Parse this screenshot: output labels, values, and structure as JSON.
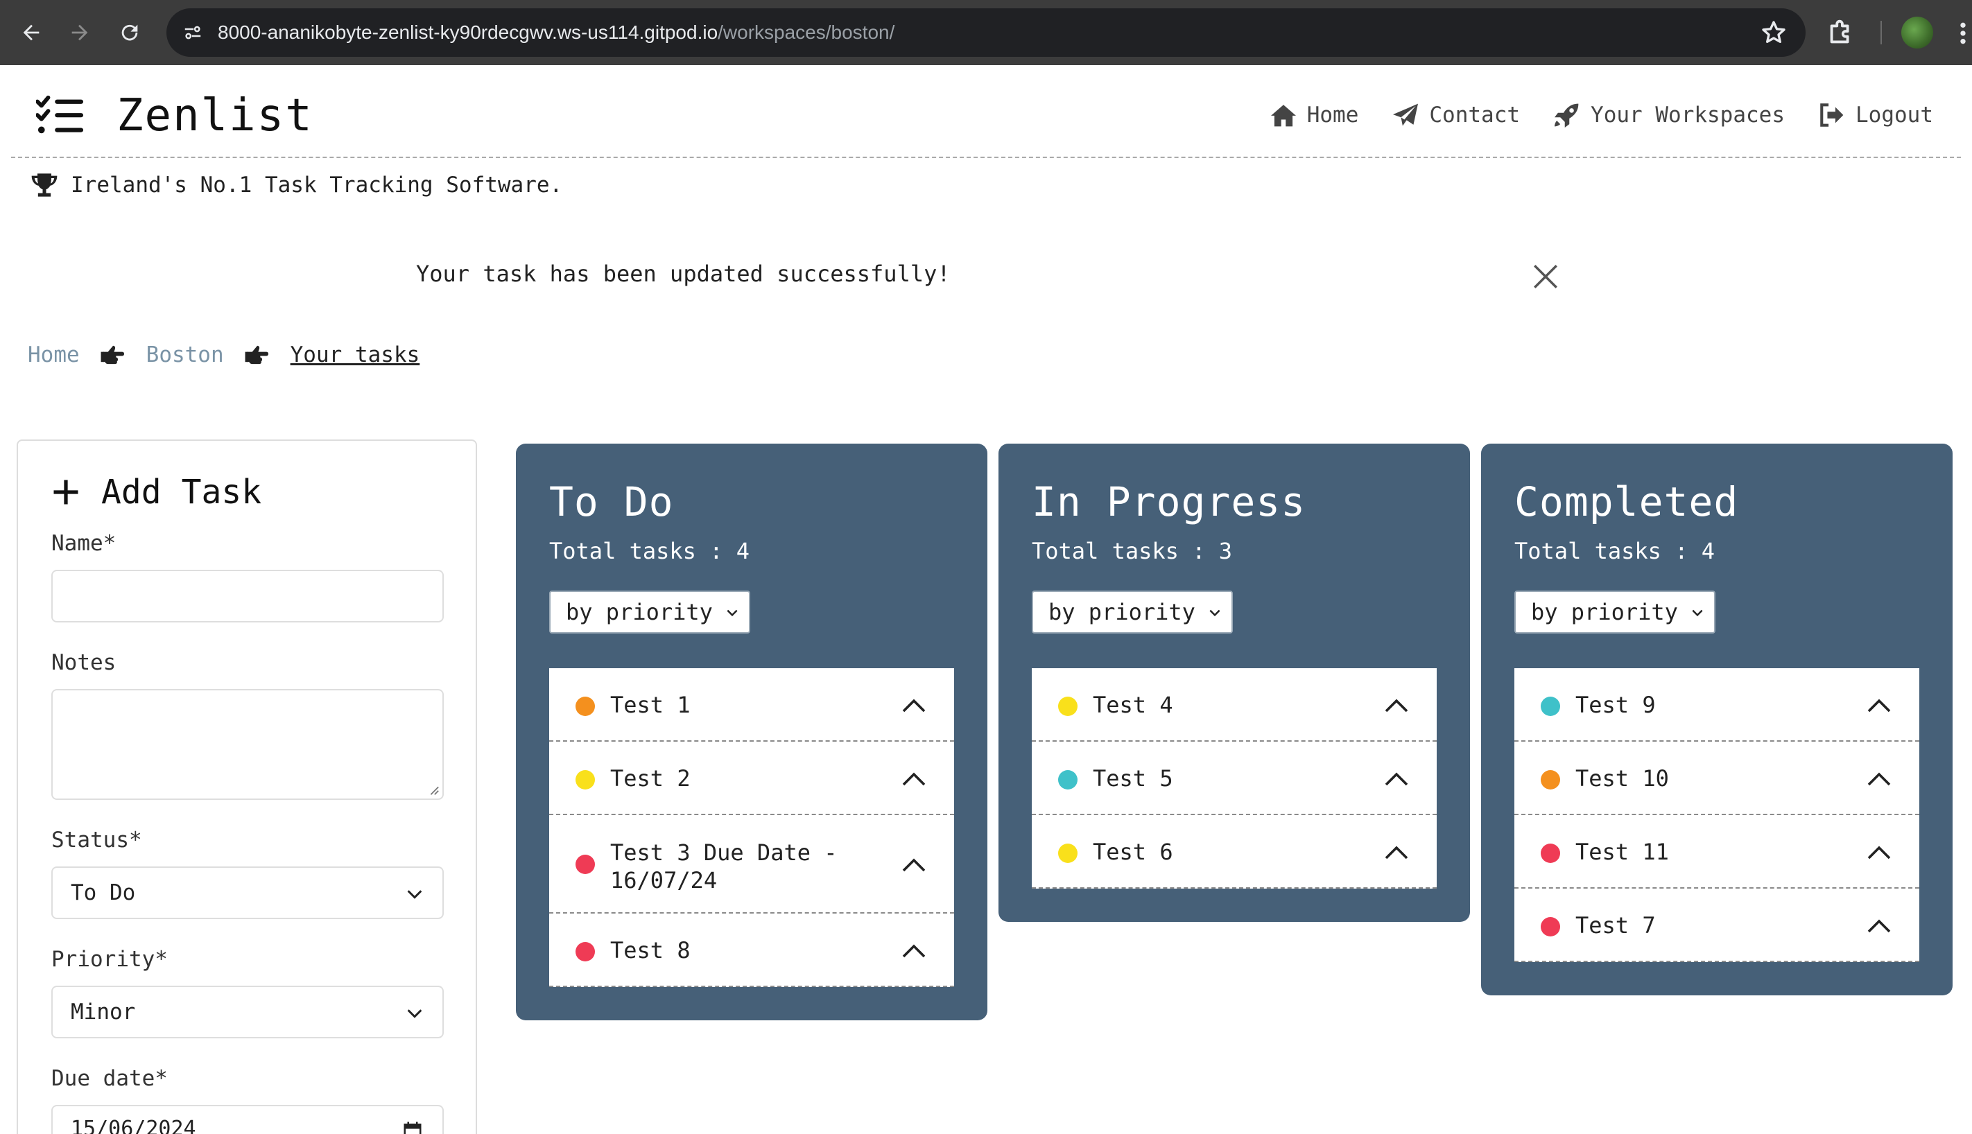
{
  "browser": {
    "url_host": "8000-ananikobyte-zenlist-ky90rdecgwv.ws-us114.gitpod.io",
    "url_path": "/workspaces/boston/"
  },
  "header": {
    "brand": "Zenlist",
    "nav": [
      {
        "label": "Home",
        "icon": "house-icon"
      },
      {
        "label": "Contact",
        "icon": "paper-plane-icon"
      },
      {
        "label": "Your Workspaces",
        "icon": "rocket-icon"
      },
      {
        "label": "Logout",
        "icon": "logout-icon"
      }
    ],
    "tagline": "Ireland's No.1 Task Tracking Software."
  },
  "alert": {
    "message": "Your task has been updated successfully!"
  },
  "breadcrumb": [
    {
      "label": "Home"
    },
    {
      "label": "Boston"
    },
    {
      "label": "Your tasks"
    }
  ],
  "add_task": {
    "title": "Add Task",
    "name_label": "Name*",
    "name_value": "",
    "notes_label": "Notes",
    "notes_value": "",
    "status_label": "Status*",
    "status_value": "To Do",
    "priority_label": "Priority*",
    "priority_value": "Minor",
    "due_label": "Due date*",
    "due_value": "15/06/2024"
  },
  "colors": {
    "board": "#466078",
    "priority_orange": "#f4901e",
    "priority_yellow": "#f9e01b",
    "priority_red": "#ef3b55",
    "priority_teal": "#3fc1c9"
  },
  "boards": [
    {
      "title": "To Do",
      "count_text": "Total tasks : 4",
      "sort": "by priority",
      "tasks": [
        {
          "name": "Test 1",
          "color": "#f4901e"
        },
        {
          "name": "Test 2",
          "color": "#f9e01b"
        },
        {
          "name": "Test 3 Due Date - 16/07/24",
          "color": "#ef3b55"
        },
        {
          "name": "Test 8",
          "color": "#ef3b55"
        }
      ]
    },
    {
      "title": "In Progress",
      "count_text": "Total tasks : 3",
      "sort": "by priority",
      "tasks": [
        {
          "name": "Test 4",
          "color": "#f9e01b"
        },
        {
          "name": "Test 5",
          "color": "#3fc1c9"
        },
        {
          "name": "Test 6",
          "color": "#f9e01b"
        }
      ]
    },
    {
      "title": "Completed",
      "count_text": "Total tasks : 4",
      "sort": "by priority",
      "tasks": [
        {
          "name": "Test 9",
          "color": "#3fc1c9"
        },
        {
          "name": "Test 10",
          "color": "#f4901e"
        },
        {
          "name": "Test 11",
          "color": "#ef3b55"
        },
        {
          "name": "Test 7",
          "color": "#ef3b55"
        }
      ]
    }
  ]
}
